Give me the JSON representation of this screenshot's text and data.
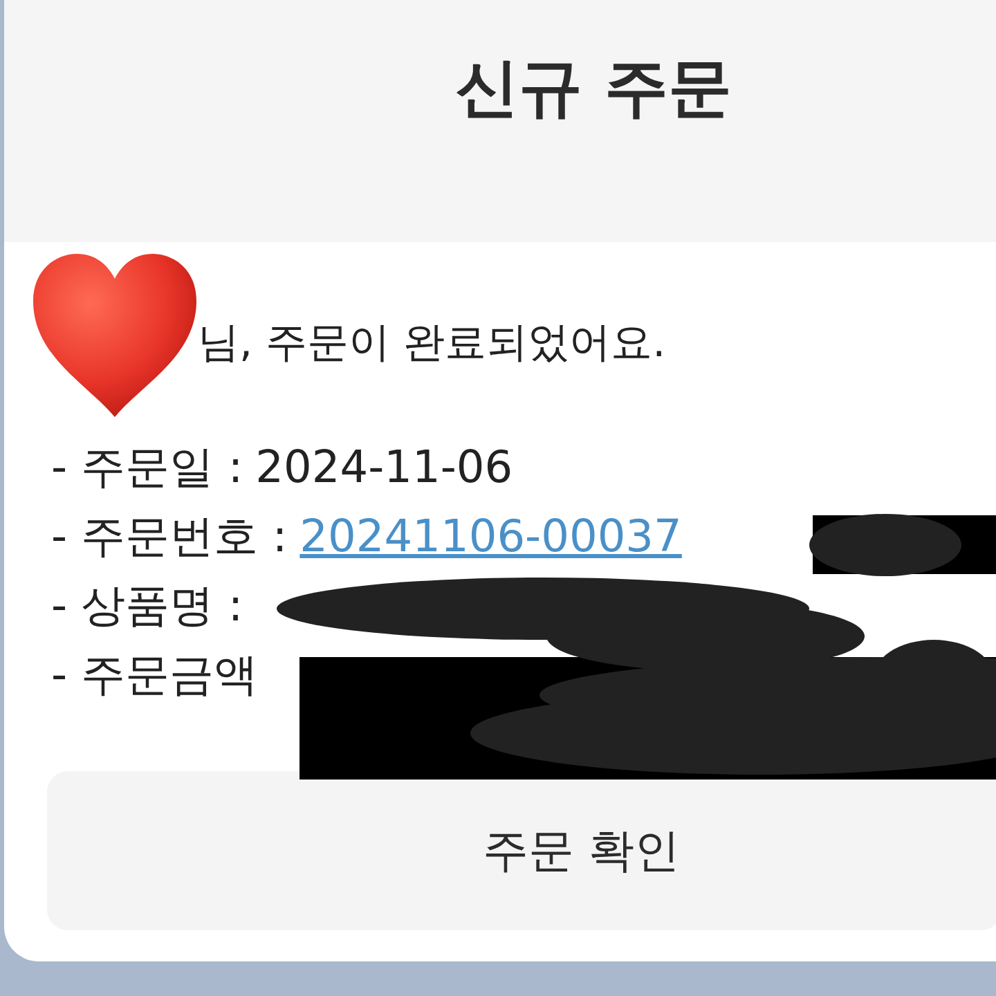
{
  "header": {
    "title": "신규 주문"
  },
  "greeting": "님, 주문이 완료되었어요.",
  "details": [
    {
      "label": "- 주문일 :",
      "value": "2024-11-06",
      "kind": "text"
    },
    {
      "label": "- 주문번호 :",
      "value": "20241106-00037",
      "kind": "link"
    },
    {
      "label": "- 상품명 :"
    },
    {
      "label": "- 주문금액"
    }
  ],
  "button": {
    "label": "주문 확인"
  }
}
